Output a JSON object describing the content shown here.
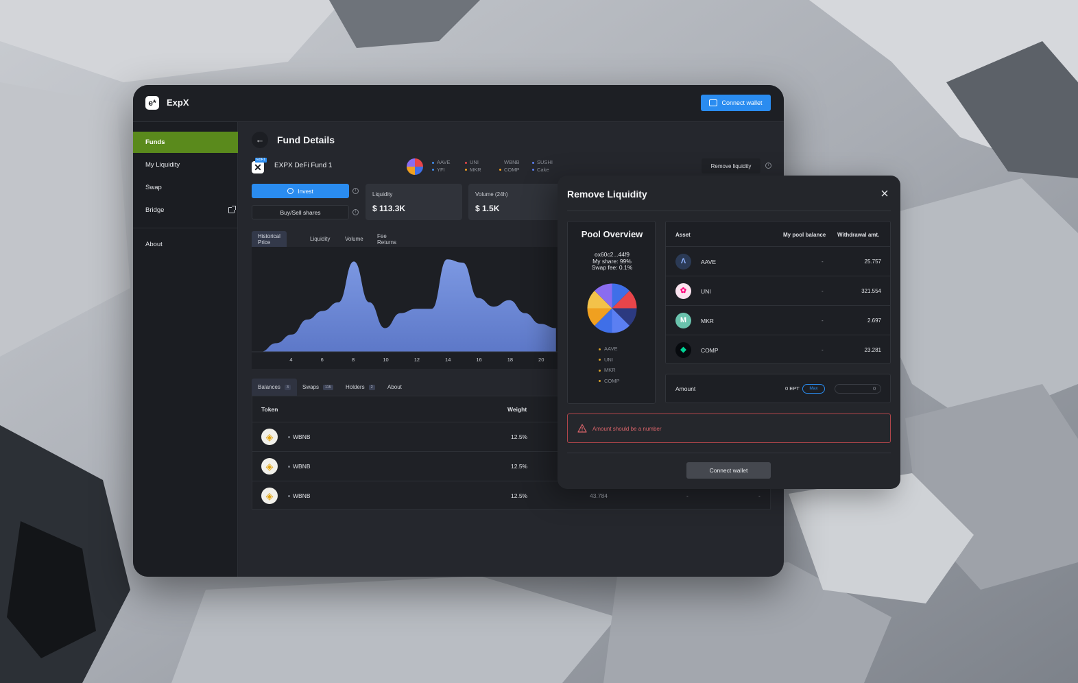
{
  "app": {
    "name": "ExpX",
    "logo_glyph": "e*",
    "connect_wallet": "Connect wallet"
  },
  "sidebar": {
    "items": [
      {
        "label": "Funds",
        "active": true
      },
      {
        "label": "My Liquidity"
      },
      {
        "label": "Swap"
      },
      {
        "label": "Bridge",
        "icon": "external-link-icon"
      },
      {
        "label": "About"
      }
    ]
  },
  "page": {
    "title": "Fund Details",
    "back_icon": "←"
  },
  "fund": {
    "name": "EXPX DeFi Fund 1",
    "badge": "EDF1",
    "legend_cols": [
      [
        {
          "label": "AAVE",
          "color": "#3f8ff0"
        },
        {
          "label": "YFI",
          "color": "#3f8ff0"
        }
      ],
      [
        {
          "label": "UNI",
          "color": "#e8454a"
        },
        {
          "label": "MKR",
          "color": "#f0a020"
        }
      ],
      [
        {
          "label": "WBNB",
          "color": "#25272d"
        },
        {
          "label": "COMP",
          "color": "#f0a020"
        }
      ],
      [
        {
          "label": "SUSHI",
          "color": "#5b7ff2"
        },
        {
          "label": "Cake",
          "color": "#5b7ff2"
        }
      ]
    ],
    "remove_liquidity": "Remove liquidity"
  },
  "actions": {
    "invest": "Invest",
    "buy_sell": "Buy/Sell shares"
  },
  "stats": [
    {
      "label": "Liquidity",
      "value": "$ 113.3K"
    },
    {
      "label": "Volume (24h)",
      "value": "$ 1.5K"
    }
  ],
  "chart_tabs": [
    "Historical Price",
    "Liquidity",
    "Volume",
    "Fee Returns"
  ],
  "chart_data": {
    "type": "area",
    "x": [
      2,
      3,
      4,
      5,
      6,
      7,
      8,
      9,
      10,
      11,
      12,
      13,
      14,
      15,
      16,
      17,
      18,
      19,
      20,
      21
    ],
    "values": [
      0,
      8,
      16,
      30,
      38,
      46,
      84,
      46,
      22,
      36,
      40,
      40,
      86,
      83,
      50,
      42,
      48,
      36,
      26,
      22
    ],
    "x_ticks": [
      "4",
      "6",
      "8",
      "10",
      "12",
      "14",
      "16",
      "18",
      "20"
    ],
    "color": "#7c98e2"
  },
  "table_tabs": [
    {
      "label": "Balances",
      "count": "3",
      "active": true
    },
    {
      "label": "Swaps",
      "count": "115"
    },
    {
      "label": "Holders",
      "count": "2"
    },
    {
      "label": "About"
    }
  ],
  "token_table": {
    "headers": {
      "token": "Token",
      "weight": "Weight"
    },
    "rows": [
      {
        "token": "WBNB",
        "weight": "12.5%"
      },
      {
        "token": "WBNB",
        "weight": "12.5%"
      },
      {
        "token": "WBNB",
        "weight": "12.5%",
        "value": "43.784",
        "c1": "-",
        "c2": "-"
      }
    ]
  },
  "modal": {
    "title": "Remove Liquidity",
    "pool": {
      "title": "Pool Overview",
      "address": "ox60c2...44f9",
      "share": "My share: 99%",
      "fee": "Swap fee: 0.1%",
      "legend": [
        "AAVE",
        "UNI",
        "MKR",
        "COMP"
      ]
    },
    "asset_headers": {
      "asset": "Asset",
      "balance": "My pool balance",
      "withdraw": "Withdrawal amt."
    },
    "assets": [
      {
        "name": "AAVE",
        "balance": "-",
        "withdraw": "25.757",
        "icon_glyph": "Λ",
        "bg": "#2b3a55",
        "fg": "#8fb3ff"
      },
      {
        "name": "UNI",
        "balance": "-",
        "withdraw": "321.554",
        "icon_glyph": "✿",
        "bg": "#fbe3ef",
        "fg": "#ff007a"
      },
      {
        "name": "MKR",
        "balance": "-",
        "withdraw": "2.697",
        "icon_glyph": "M",
        "bg": "#6ac3ad",
        "fg": "#ffffff"
      },
      {
        "name": "COMP",
        "balance": "-",
        "withdraw": "23.281",
        "icon_glyph": "◆",
        "bg": "#070a0e",
        "fg": "#00d395"
      }
    ],
    "amount": {
      "label": "Amount",
      "balance": "0 EPT",
      "max": "Max",
      "value": "0"
    },
    "error": "Amount should be a number",
    "connect_wallet": "Connect wallet"
  }
}
